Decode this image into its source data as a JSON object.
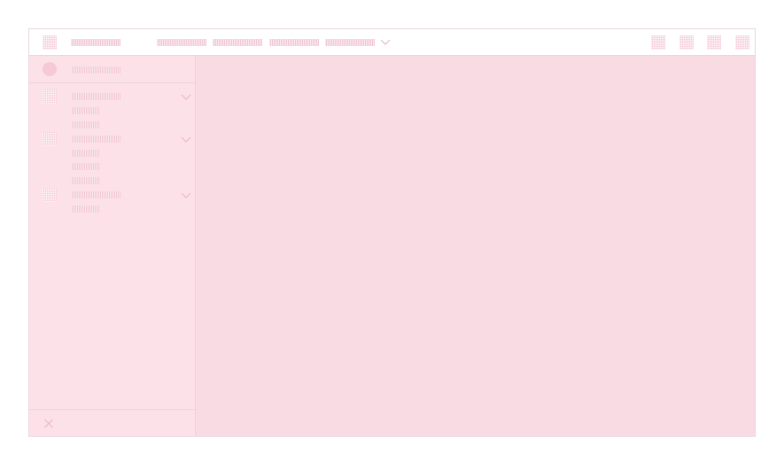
{
  "theme": {
    "accent": "#f3c9d6",
    "background": "#fbdde6",
    "sidebar_background": "#fde1e9",
    "border": "#ead6dd"
  },
  "topbar": {
    "logo_icon": "app-logo-placeholder-icon",
    "brand": "",
    "nav_items": [
      {
        "label": ""
      },
      {
        "label": ""
      },
      {
        "label": ""
      },
      {
        "label": "",
        "has_dropdown": true
      }
    ],
    "action_icons": [
      "action-1-icon",
      "action-2-icon",
      "action-3-icon",
      "action-4-icon"
    ]
  },
  "sidebar": {
    "profile": {
      "avatar_icon": "avatar-circle-icon",
      "name": ""
    },
    "groups": [
      {
        "icon": "group-1-icon",
        "label": "",
        "expanded": true,
        "items": [
          {
            "label": ""
          },
          {
            "label": ""
          }
        ]
      },
      {
        "icon": "group-2-icon",
        "label": "",
        "expanded": true,
        "items": [
          {
            "label": ""
          },
          {
            "label": ""
          },
          {
            "label": ""
          }
        ]
      },
      {
        "icon": "group-3-icon",
        "label": "",
        "expanded": true,
        "items": [
          {
            "label": ""
          }
        ]
      }
    ],
    "footer": {
      "close_icon": "close-icon"
    }
  },
  "main": {}
}
